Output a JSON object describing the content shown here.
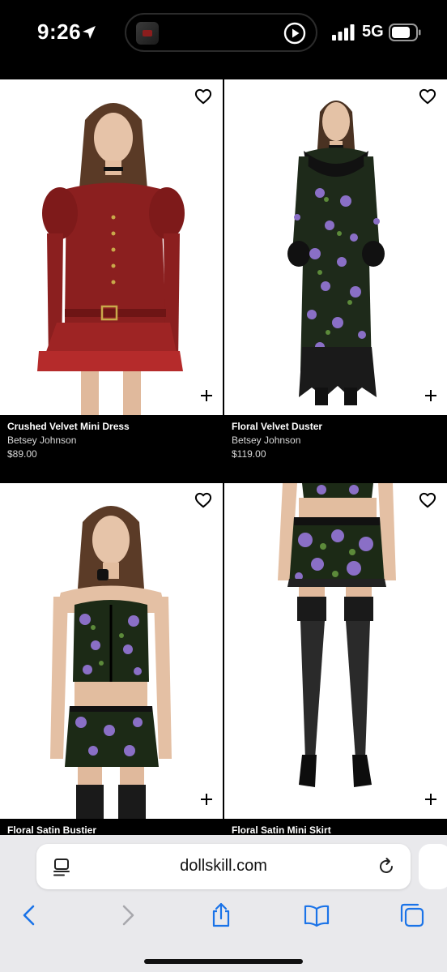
{
  "status_bar": {
    "time": "9:26",
    "network": "5G",
    "icons": [
      "location-arrow-icon",
      "play-icon",
      "signal-bars-icon",
      "battery-icon"
    ]
  },
  "products": [
    {
      "name": "Crushed Velvet Mini Dress",
      "brand": "Betsey Johnson",
      "price": "$89.00",
      "color": "#8b1f1f"
    },
    {
      "name": "Floral Velvet Duster",
      "brand": "Betsey Johnson",
      "price": "$119.00",
      "color": "#6b4a9c"
    },
    {
      "name": "Floral Satin Bustier",
      "brand": "",
      "price": "",
      "color": "#7a5fb0"
    },
    {
      "name": "Floral Satin Mini Skirt",
      "brand": "",
      "price": "",
      "color": "#7a5fb0"
    }
  ],
  "browser": {
    "url": "dollskill.com",
    "accent_color": "#1a73e8",
    "toolbar_icons": [
      "back-icon",
      "forward-icon",
      "share-icon",
      "bookmarks-icon",
      "tabs-icon"
    ]
  }
}
